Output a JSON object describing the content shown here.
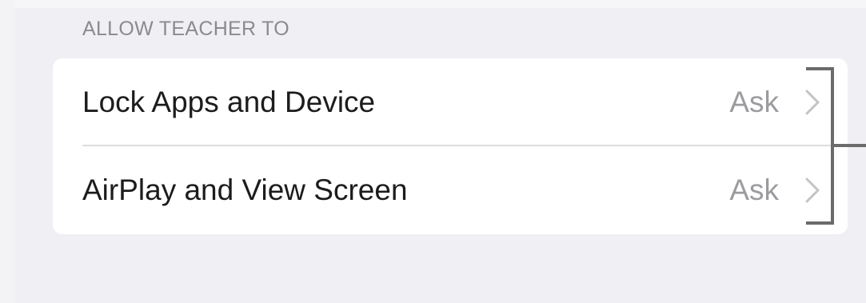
{
  "section": {
    "header": "ALLOW TEACHER TO"
  },
  "rows": [
    {
      "label": "Lock Apps and Device",
      "value": "Ask"
    },
    {
      "label": "AirPlay and View Screen",
      "value": "Ask"
    }
  ],
  "icons": {
    "row_disclosure": "chevron-right-icon",
    "annotation": "bracket-callout-icon"
  },
  "colors": {
    "background": "#efeff4",
    "card": "#ffffff",
    "label_text": "#1c1c1e",
    "value_text": "#9b9ba0",
    "header_text": "#8a8a8f",
    "chevron": "#c4c4c8",
    "annotation_line": "#6b6b6b"
  }
}
